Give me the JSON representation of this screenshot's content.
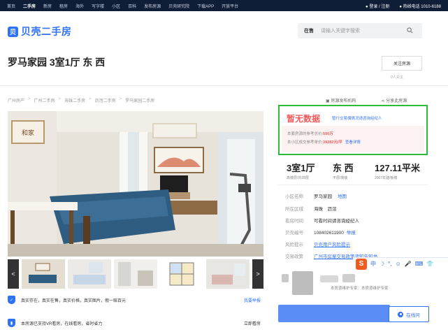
{
  "topnav": {
    "items": [
      "首页",
      "二手房",
      "新房",
      "租房",
      "海外",
      "写字楼",
      "小区",
      "百科",
      "发布房源",
      "贝壳研究院",
      "下载APP",
      "开放平台"
    ],
    "active_index": 1,
    "login": "登录 / 注册",
    "hotline": "热线电话 1010-6188"
  },
  "logo": {
    "mark": "贝",
    "text": "贝壳二手房"
  },
  "search": {
    "category": "在售",
    "placeholder": "请输入关键字搜索"
  },
  "title": "罗马家园 3室1厅 东 西",
  "follow": {
    "button": "关注房源",
    "count": "0人关注"
  },
  "breadcrumbs": [
    "广州房产",
    "广州二手房",
    "海珠二手房",
    "沥滘二手房",
    "罗马家园二手房"
  ],
  "top_actions": {
    "publisher": "房源发布机构",
    "share": "分享此房源"
  },
  "gallery": {
    "prev": "<",
    "next": ">"
  },
  "features": [
    {
      "text": "真实存在，真实在售，真实价格，真实图片，假一赔百元",
      "link": "我要举报"
    },
    {
      "text": "本房源已支持VR看房，在线看房，省时省力",
      "link": "立即看房"
    }
  ],
  "price": {
    "nodata": "暂无数据",
    "tip": "暂行交易價情况请咨询经纪人",
    "ref_total_label": "本套房源的参考总价:",
    "ref_total_value": "500万",
    "ref_unit_label": "本小区成交参考单价:",
    "ref_unit_value": "39282元/平",
    "ref_unit_link": "查看详情"
  },
  "stats": [
    {
      "big": "3室1厅",
      "small": "高楼层/共28层"
    },
    {
      "big": "东 西",
      "small": "平层/简装"
    },
    {
      "big": "127.11平米",
      "small": "2007年建/板楼"
    }
  ],
  "info": [
    {
      "label": "小区名称",
      "value": "罗马家园",
      "link": "地图"
    },
    {
      "label": "所在区域",
      "value": "海珠　沥滘",
      "link": ""
    },
    {
      "label": "看房时间",
      "value": "可看时间请咨询经纪人",
      "link": ""
    },
    {
      "label": "贝壳编号",
      "value": "108402611900",
      "link": "举报"
    },
    {
      "label": "风险提示",
      "value": "贝壳用户风险提示",
      "link": ""
    },
    {
      "label": "交易政策",
      "value": "广州市房屋交易政策须知告知书",
      "link": ""
    }
  ],
  "ime": {
    "logo": "S",
    "items": [
      "中",
      "☽",
      "°,",
      "☺",
      "🎤",
      "⌨",
      "👕"
    ]
  },
  "agent": {
    "subtitle": "本房源维护专家：本房源维护专家"
  },
  "contact": {
    "online": "在线问"
  }
}
